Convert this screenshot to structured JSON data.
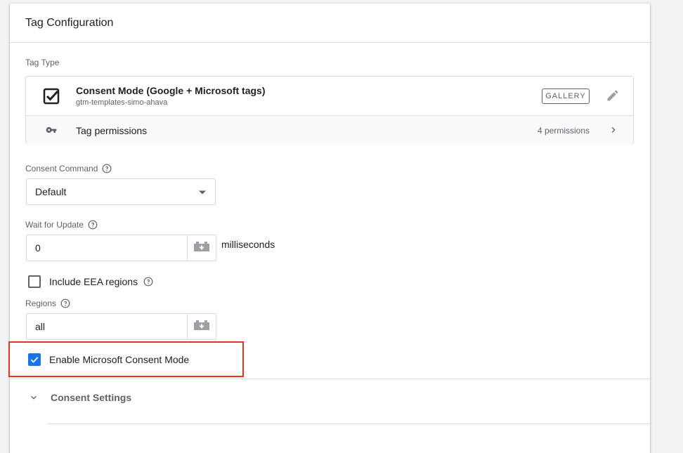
{
  "panel": {
    "title": "Tag Configuration"
  },
  "tag_type": {
    "label": "Tag Type",
    "name": "Consent Mode (Google + Microsoft tags)",
    "publisher": "gtm-templates-simo-ahava",
    "badge": "GALLERY",
    "permissions_label": "Tag permissions",
    "permissions_count": "4 permissions"
  },
  "consent_command": {
    "label": "Consent Command",
    "value": "Default"
  },
  "wait_for_update": {
    "label": "Wait for Update",
    "value": "0",
    "unit": "milliseconds"
  },
  "include_eea": {
    "label": "Include EEA regions",
    "checked": false
  },
  "regions": {
    "label": "Regions",
    "value": "all"
  },
  "microsoft_consent": {
    "label": "Enable Microsoft Consent Mode",
    "checked": true
  },
  "consent_settings": {
    "label": "Consent Settings"
  },
  "colors": {
    "accent": "#1a73e8",
    "highlight": "#e8341c",
    "text_secondary": "#5f6368"
  }
}
